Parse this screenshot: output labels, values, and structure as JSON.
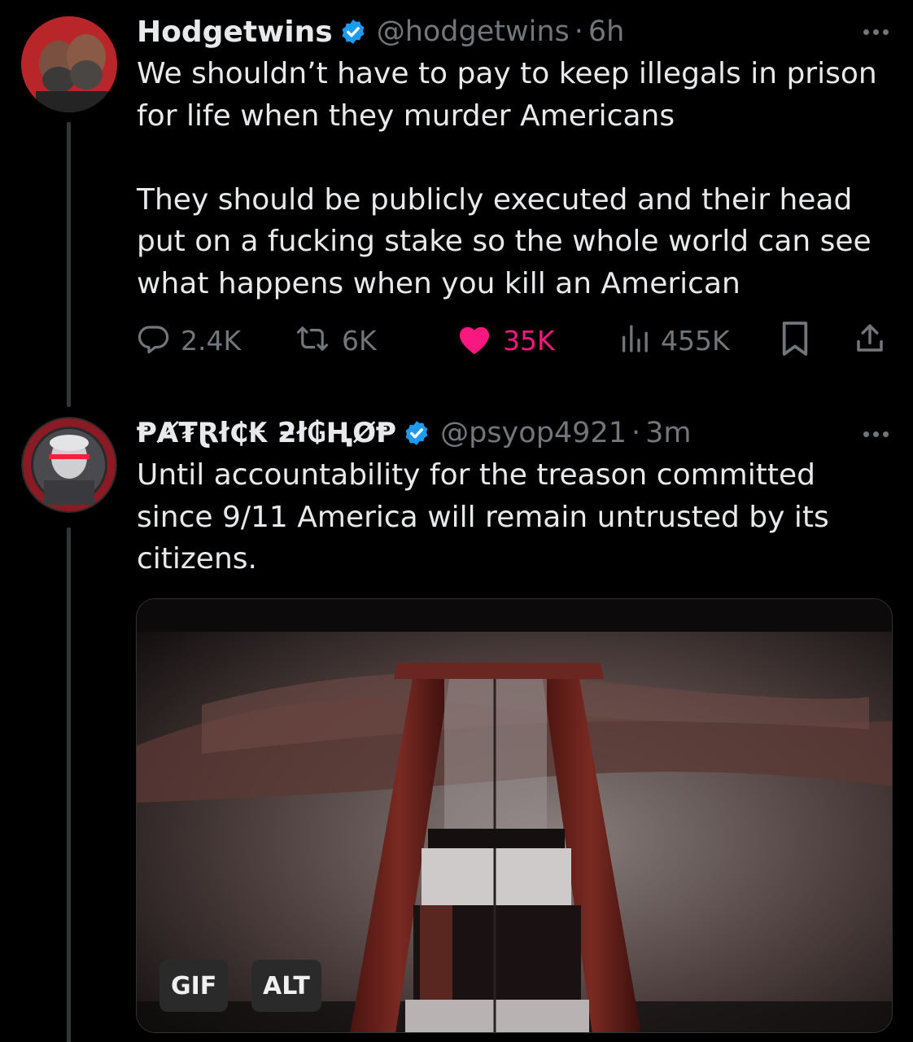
{
  "tweets": [
    {
      "name": "Hodgetwins",
      "handle": "@hodgetwins",
      "separator": "·",
      "time": "6h",
      "verified": true,
      "text": "We shouldn’t have to pay to keep illegals in prison for life when they murder Americans\n\nThey should be publicly executed and their head put on a fucking stake so the whole world can see what happens when you kill an American",
      "stats": {
        "replies": "2.4K",
        "reposts": "6K",
        "likes": "35K",
        "views": "455K"
      },
      "liked": true
    },
    {
      "name": "ⱣȺ₮Ɽł₵₭ ƻł₲ⱧØⱣ",
      "handle": "@psyop4921",
      "separator": "·",
      "time": "3m",
      "verified": true,
      "text": "Until accountability for the treason committed since 9/11 America will remain untrusted by its citizens.",
      "media": {
        "gif_label": "GIF",
        "alt_label": "ALT"
      }
    }
  ],
  "icons": {
    "verified_badge": "verified-badge-icon",
    "reply": "reply-icon",
    "repost": "repost-icon",
    "like": "heart-icon",
    "views": "views-icon",
    "bookmark": "bookmark-icon",
    "share": "share-icon",
    "more": "more-icon"
  },
  "colors": {
    "background": "#000000",
    "text_primary": "#e7e9ea",
    "text_secondary": "#71767b",
    "verified_blue": "#1d9bf0",
    "like_pink": "#f91880",
    "thread_line": "#333639"
  }
}
